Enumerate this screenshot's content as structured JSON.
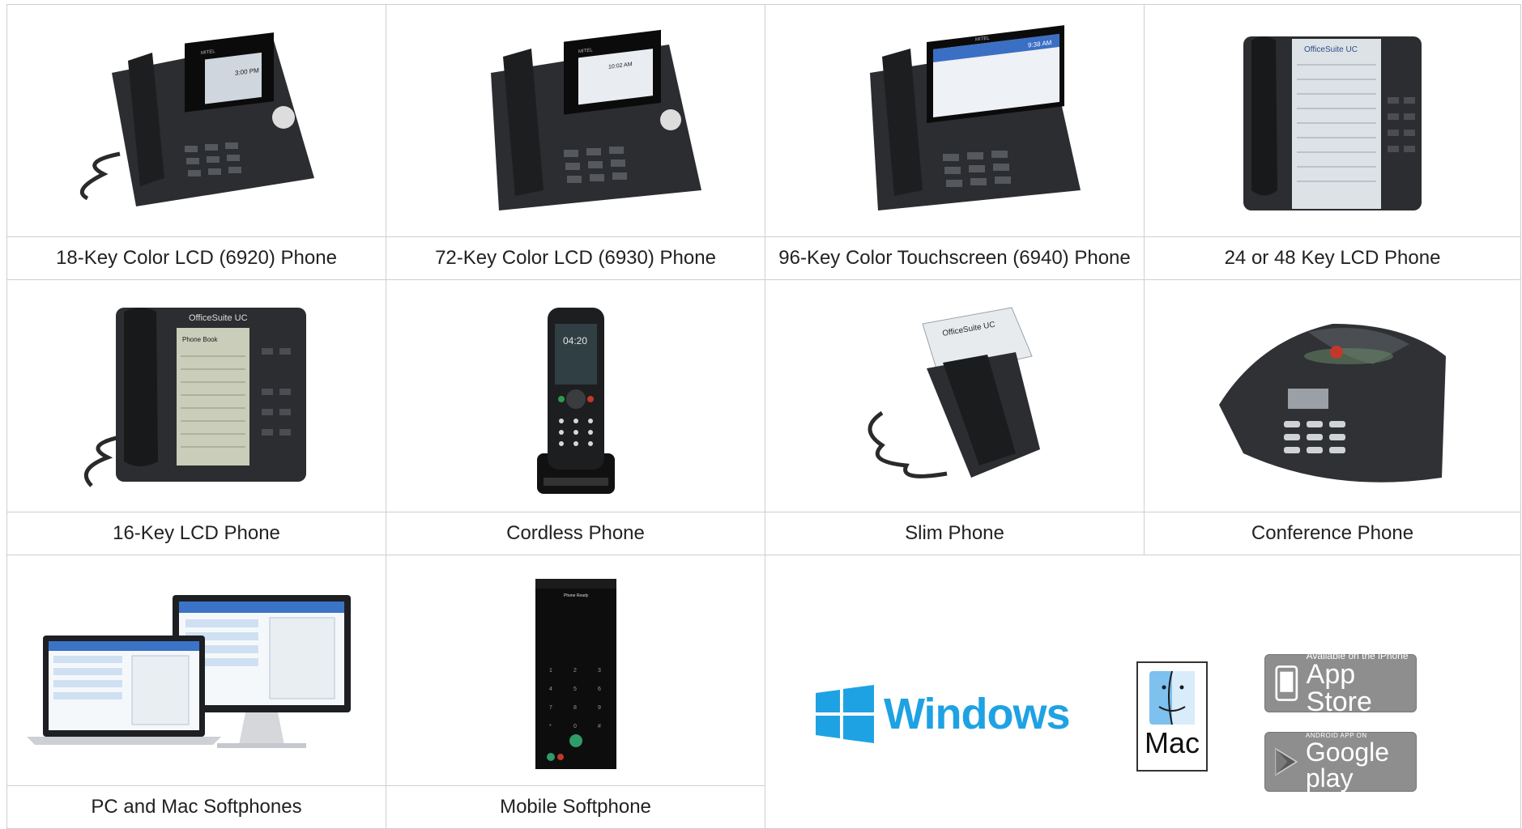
{
  "products": [
    {
      "caption": "18-Key Color LCD (6920) Phone",
      "icon": "desk-phone-icon",
      "screen": {
        "brand": "MITEL",
        "time": "3:00 PM"
      }
    },
    {
      "caption": "72-Key Color LCD (6930) Phone",
      "icon": "desk-phone-icon",
      "screen": {
        "brand": "MITEL",
        "time": "10:02 AM"
      }
    },
    {
      "caption": "96-Key Color Touchscreen (6940) Phone",
      "icon": "touchscreen-phone-icon",
      "screen": {
        "brand": "MITEL",
        "time": "9:38 AM"
      }
    },
    {
      "caption": "24 or 48 Key LCD Phone",
      "icon": "lcd-phone-icon",
      "screen": {
        "brand": "OfficeSuite UC"
      }
    },
    {
      "caption": "16-Key LCD Phone",
      "icon": "lcd-phone-icon",
      "screen": {
        "brand": "OfficeSuite UC",
        "title": "Phone Book"
      }
    },
    {
      "caption": "Cordless Phone",
      "icon": "cordless-phone-icon",
      "screen": {
        "time": "04:20"
      }
    },
    {
      "caption": "Slim Phone",
      "icon": "slim-phone-icon",
      "screen": {
        "brand": "OfficeSuite UC"
      }
    },
    {
      "caption": "Conference Phone",
      "icon": "conference-phone-icon",
      "screen": {}
    },
    {
      "caption": "PC and Mac Softphones",
      "icon": "desktop-softphone-icon",
      "screen": {}
    },
    {
      "caption": "Mobile Softphone",
      "icon": "mobile-softphone-icon",
      "screen": {
        "title": "Phone Ready"
      }
    }
  ],
  "platforms": {
    "windows": {
      "label": "Windows",
      "icon": "windows-logo-icon",
      "color": "#1fa2e3"
    },
    "mac": {
      "label": "Mac",
      "icon": "mac-finder-icon"
    },
    "app_store": {
      "small": "Available on the iPhone",
      "large": "App Store",
      "icon": "apple-app-store-badge-icon"
    },
    "google_play": {
      "small": "ANDROID APP ON",
      "large": "Google play",
      "icon": "google-play-badge-icon"
    }
  },
  "colors": {
    "border": "#cfcfcf",
    "badge": "#8e8e8e",
    "phone_dark": "#2b2d30"
  }
}
